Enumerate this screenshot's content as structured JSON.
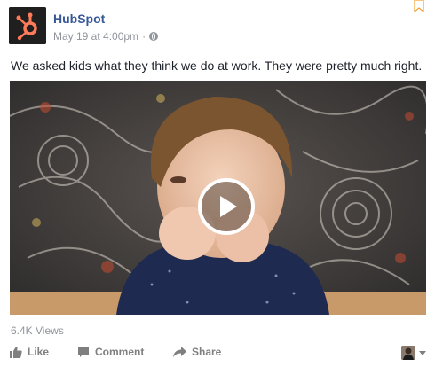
{
  "post": {
    "page_name": "HubSpot",
    "timestamp": "May 19 at 4:00pm",
    "separator": "·",
    "audience_icon": "globe-icon",
    "message": "We asked kids what they think we do at work. They were pretty much right.",
    "video": {
      "play_icon": "play-icon",
      "views": "6.4K Views"
    }
  },
  "actions": {
    "like_label": "Like",
    "comment_label": "Comment",
    "share_label": "Share"
  },
  "colors": {
    "link": "#365899",
    "brand_orange": "#ff7a59",
    "muted": "#90949c",
    "action_grey": "#7f7f7f"
  }
}
